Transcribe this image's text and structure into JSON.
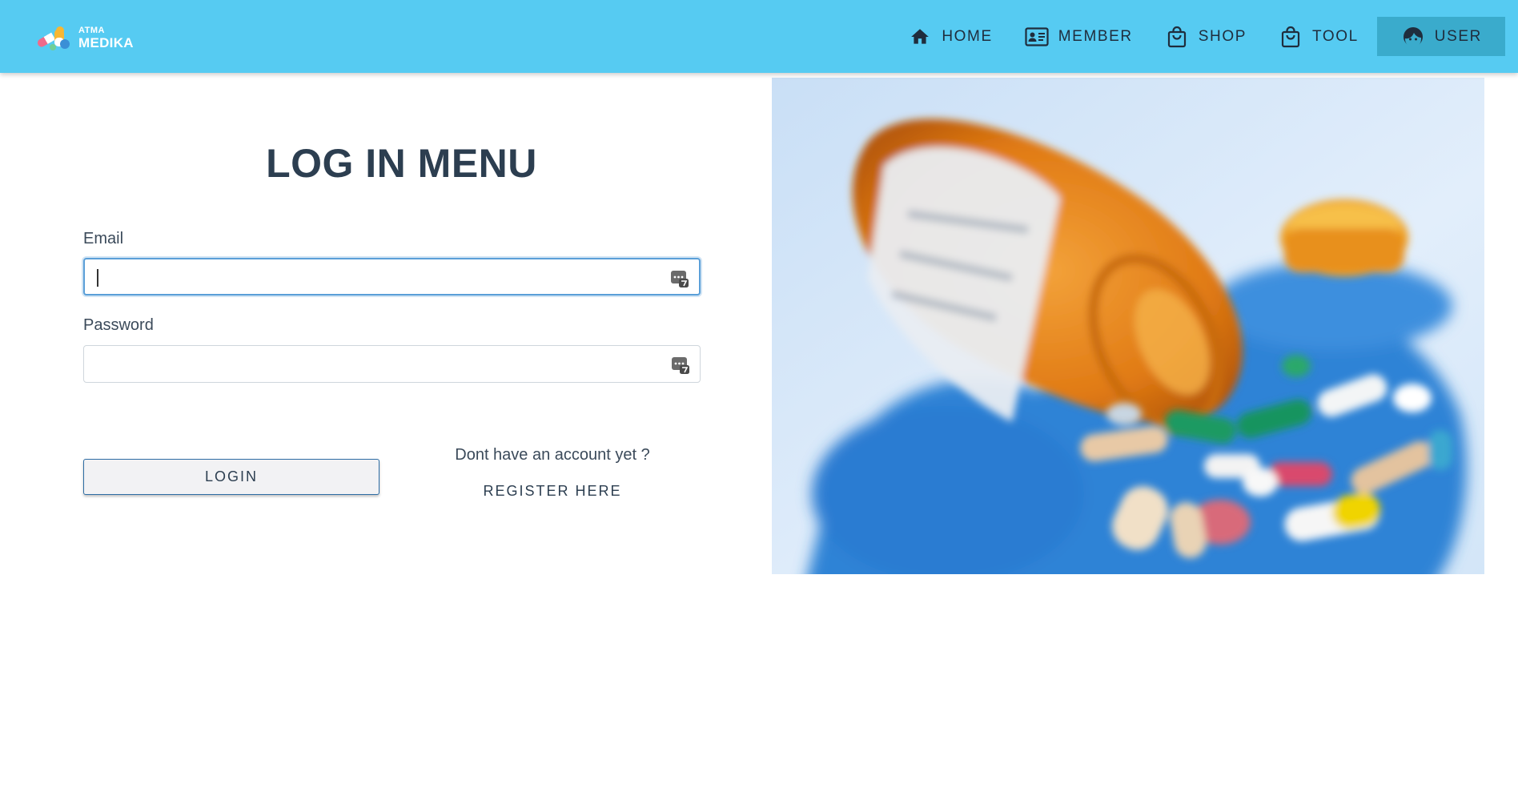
{
  "brand": {
    "logo_top": "ATMA",
    "logo_bottom": "MEDIKA"
  },
  "nav": {
    "items": [
      {
        "label": "HOME",
        "icon": "home-icon"
      },
      {
        "label": "MEMBER",
        "icon": "id-card-icon"
      },
      {
        "label": "SHOP",
        "icon": "shopping-bag-icon"
      },
      {
        "label": "TOOL",
        "icon": "shopping-bag-icon"
      },
      {
        "label": "USER",
        "icon": "face-icon",
        "active": true
      }
    ]
  },
  "login": {
    "title": "LOG IN MENU",
    "email_label": "Email",
    "email_value": "",
    "password_label": "Password",
    "password_value": "",
    "login_button": "LOGIN",
    "register_question": "Dont have an account yet ?",
    "register_link": "REGISTER HERE"
  },
  "hero": {
    "image": "medicine-bottle-and-pills-photo"
  },
  "colors": {
    "navbar": "#56cbf2",
    "nav_active": "#3aabcc",
    "title": "#2c3e50",
    "focus_border": "#5a9fd8"
  }
}
